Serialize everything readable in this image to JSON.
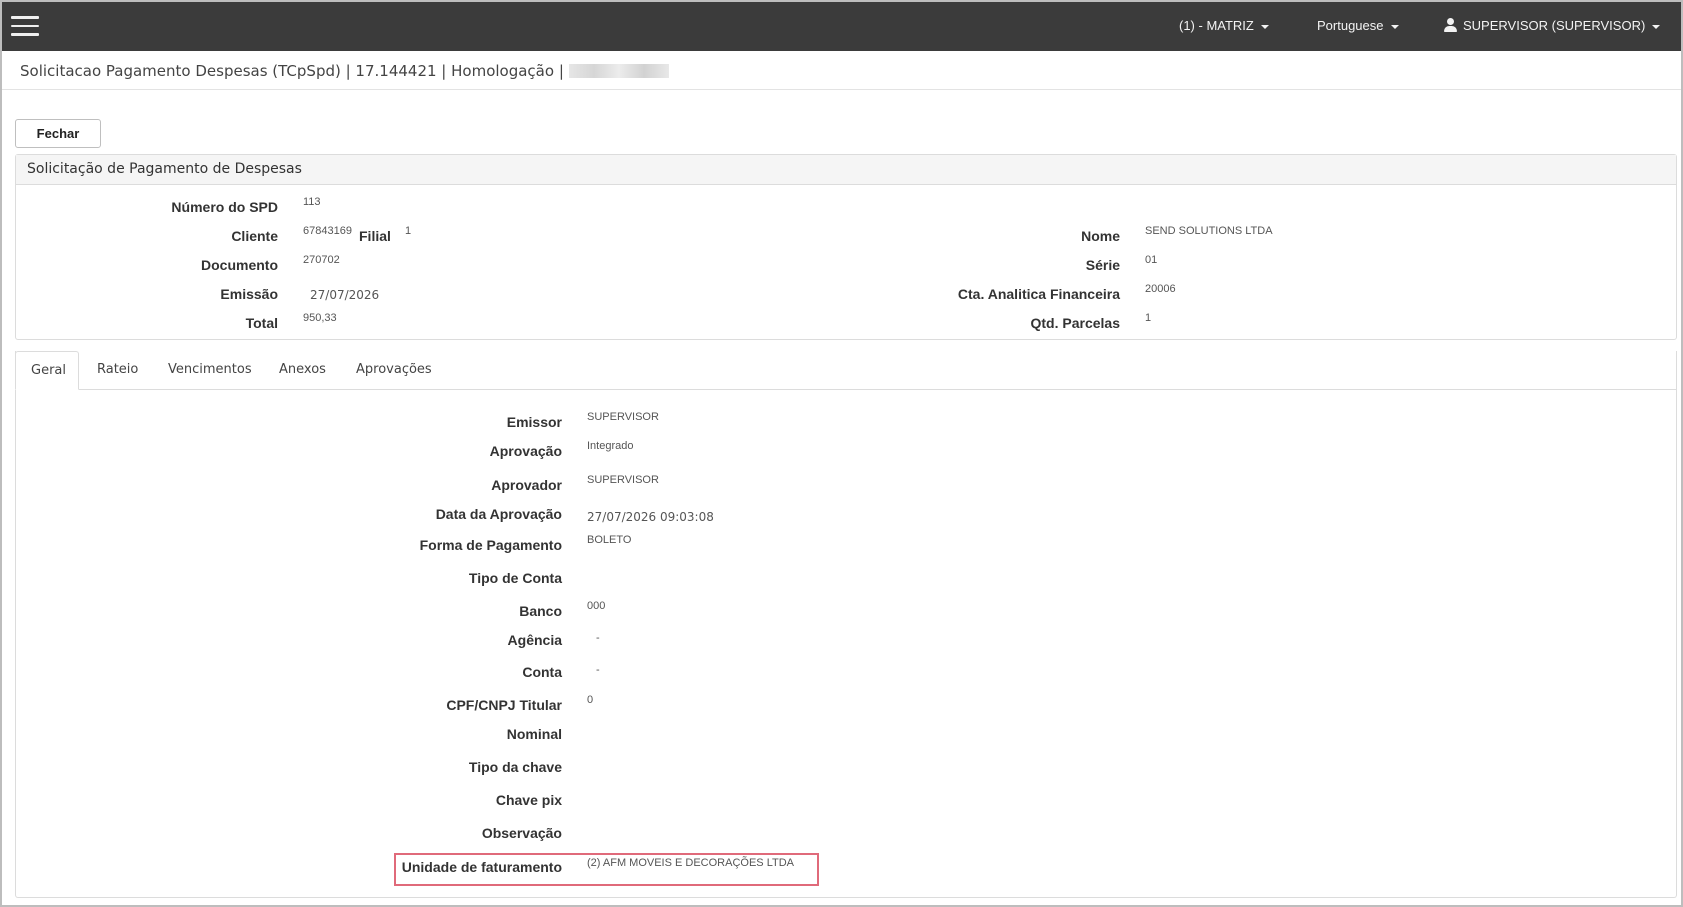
{
  "navbar": {
    "branch": "(1) - MATRIZ",
    "language": "Portuguese",
    "user": "SUPERVISOR (SUPERVISOR)"
  },
  "title": {
    "text": "Solicitacao Pagamento Despesas (TCpSpd) | 17.144421 | Homologação |"
  },
  "actions": {
    "close_label": "Fechar"
  },
  "panel": {
    "heading": "Solicitação de Pagamento de Despesas",
    "fields": {
      "numero_spd_label": "Número do SPD",
      "numero_spd_value": "113",
      "cliente_label": "Cliente",
      "cliente_value": "67843169",
      "filial_label": "Filial",
      "filial_value": "1",
      "documento_label": "Documento",
      "documento_value": "270702",
      "emissao_label": "Emissão",
      "emissao_value": "27/07/2026",
      "total_label": "Total",
      "total_value": "950,33",
      "nome_label": "Nome",
      "nome_value": "SEND SOLUTIONS LTDA",
      "serie_label": "Série",
      "serie_value": "01",
      "cta_label": "Cta. Analitica Financeira",
      "cta_value": "20006",
      "parcelas_label": "Qtd. Parcelas",
      "parcelas_value": "1"
    }
  },
  "tabs": [
    "Geral",
    "Rateio",
    "Vencimentos",
    "Anexos",
    "Aprovações"
  ],
  "geral": {
    "emissor_label": "Emissor",
    "emissor_value": "SUPERVISOR",
    "aprovacao_label": "Aprovação",
    "aprovacao_value": "Integrado",
    "aprovador_label": "Aprovador",
    "aprovador_value": "SUPERVISOR",
    "data_aprovacao_label": "Data da Aprovação",
    "data_aprovacao_value": "27/07/2026 09:03:08",
    "forma_pagamento_label": "Forma de Pagamento",
    "forma_pagamento_value": "BOLETO",
    "tipo_conta_label": "Tipo de Conta",
    "banco_label": "Banco",
    "banco_value": "000",
    "agencia_label": "Agência",
    "agencia_value": "-",
    "conta_label": "Conta",
    "conta_value": "-",
    "cpf_cnpj_label": "CPF/CNPJ Titular",
    "cpf_cnpj_value": "0",
    "nominal_label": "Nominal",
    "tipo_chave_label": "Tipo da chave",
    "chave_pix_label": "Chave pix",
    "observacao_label": "Observação",
    "unidade_label": "Unidade de faturamento",
    "unidade_value": "(2) AFM MOVEIS E DECORAÇÕES LTDA"
  },
  "colors": {
    "navbar": "#3b3b3b",
    "highlight": "#e06a7a"
  }
}
